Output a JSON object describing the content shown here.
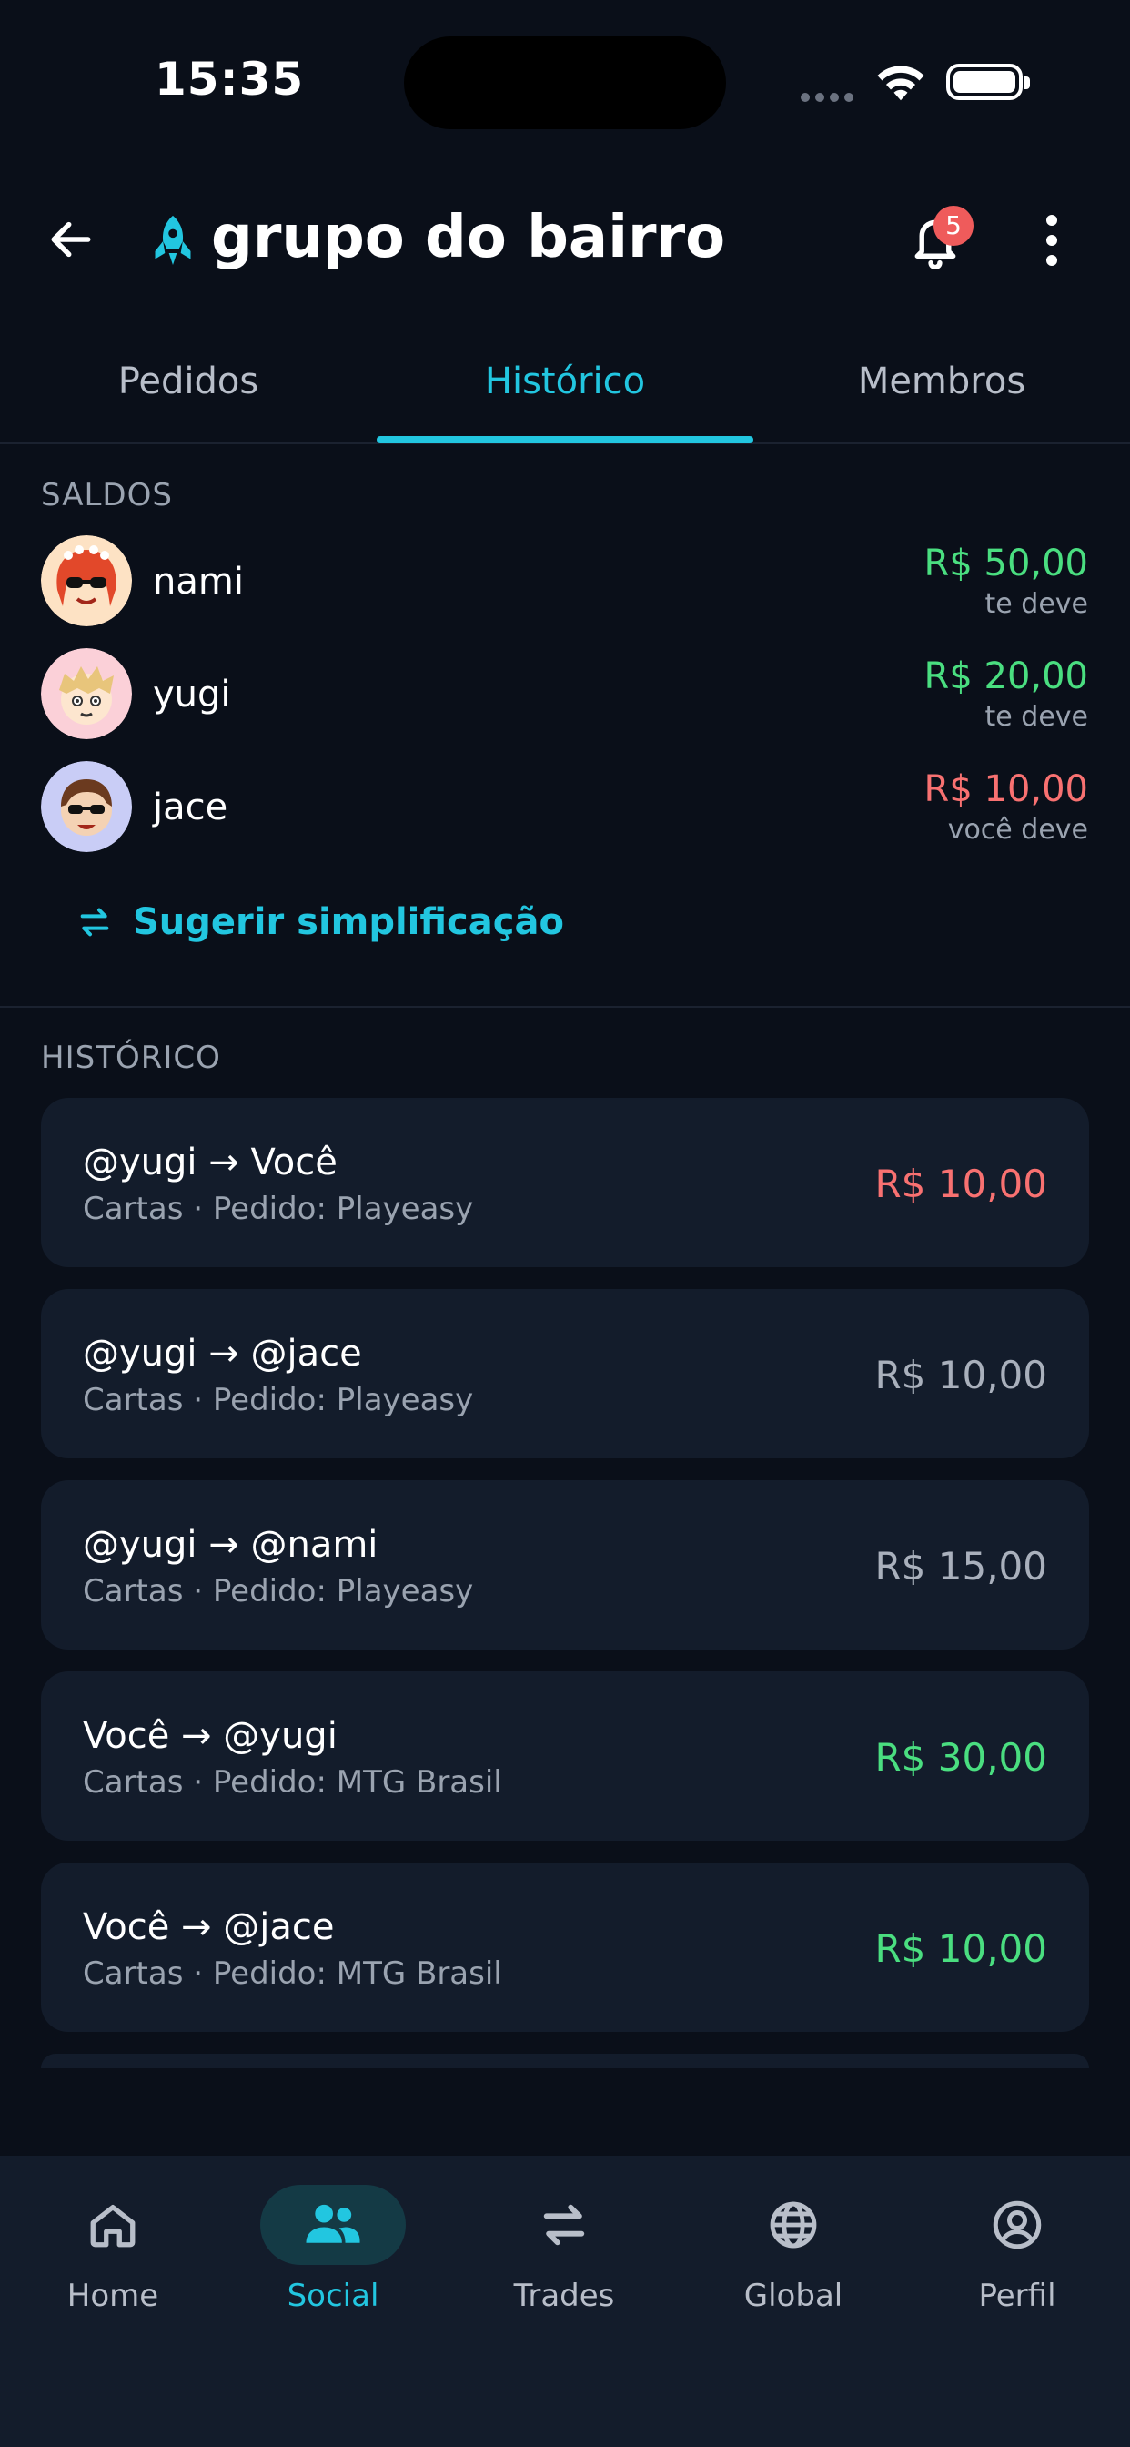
{
  "status_bar": {
    "time": "15:35"
  },
  "header": {
    "title": "grupo do bairro",
    "notification_count": "5"
  },
  "tabs": [
    {
      "label": "Pedidos",
      "active": false
    },
    {
      "label": "Histórico",
      "active": true
    },
    {
      "label": "Membros",
      "active": false
    }
  ],
  "balances": {
    "label": "SALDOS",
    "items": [
      {
        "name": "nami",
        "amount": "R$ 50,00",
        "note": "te deve",
        "status": "positive"
      },
      {
        "name": "yugi",
        "amount": "R$ 20,00",
        "note": "te deve",
        "status": "positive"
      },
      {
        "name": "jace",
        "amount": "R$ 10,00",
        "note": "você deve",
        "status": "negative"
      }
    ],
    "suggest_label": "Sugerir simplificação"
  },
  "history": {
    "label": "HISTÓRICO",
    "items": [
      {
        "title": "@yugi → Você",
        "subtitle": "Cartas · Pedido: Playeasy",
        "amount": "R$ 10,00",
        "status": "negative"
      },
      {
        "title": "@yugi → @jace",
        "subtitle": "Cartas · Pedido: Playeasy",
        "amount": "R$ 10,00",
        "status": "neutral"
      },
      {
        "title": "@yugi → @nami",
        "subtitle": "Cartas · Pedido: Playeasy",
        "amount": "R$ 15,00",
        "status": "neutral"
      },
      {
        "title": "Você → @yugi",
        "subtitle": "Cartas · Pedido: MTG Brasil",
        "amount": "R$ 30,00",
        "status": "positive"
      },
      {
        "title": "Você → @jace",
        "subtitle": "Cartas · Pedido: MTG Brasil",
        "amount": "R$ 10,00",
        "status": "positive"
      }
    ]
  },
  "bottom_nav": [
    {
      "label": "Home",
      "icon": "home-icon",
      "active": false
    },
    {
      "label": "Social",
      "icon": "people-icon",
      "active": true
    },
    {
      "label": "Trades",
      "icon": "swap-icon",
      "active": false
    },
    {
      "label": "Global",
      "icon": "globe-icon",
      "active": false
    },
    {
      "label": "Perfil",
      "icon": "user-circle-icon",
      "active": false
    }
  ],
  "colors": {
    "background": "#0a0f19",
    "card": "#131c2b",
    "accent": "#22c6e0",
    "positive": "#4ade80",
    "negative": "#f87171",
    "badge": "#ef5b5b"
  }
}
